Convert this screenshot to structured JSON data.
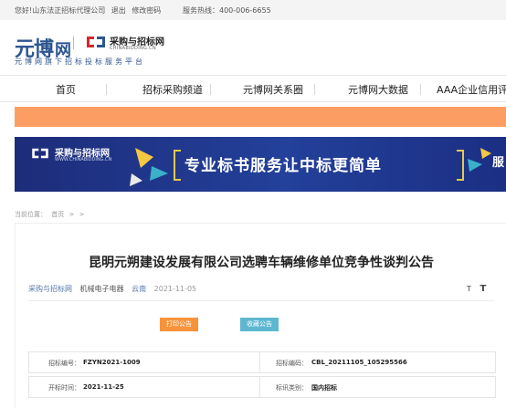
{
  "topbar": {
    "welcome_text": "您好!山东法正招标代理公司",
    "logout_label": "退出",
    "change_password_label": "修改密码",
    "hotline_text": "服务热线：400-006-6655"
  },
  "header": {
    "yuanbo_logo_text": "元博",
    "yuanbo_logo_net": "网",
    "yuanbo_sub_text": "元博网旗下招标投标服务平台",
    "caigou_name": "采购与招标网",
    "caigou_url": "CHINABIDDING.CN"
  },
  "nav": {
    "items": [
      {
        "label": "首页"
      },
      {
        "label": "招标采购频道"
      },
      {
        "label": "元博网关系圈"
      },
      {
        "label": "元博网大数据"
      },
      {
        "label": "AAA企业信用评"
      }
    ]
  },
  "banner": {
    "brand_name": "采购与招标网",
    "brand_url": "WWW.CHINABIDDING.CN",
    "slogan": "专业标书服务让中标更简单",
    "cut_text": "服"
  },
  "breadcrumb": {
    "prefix": "当前位置：",
    "home": "首页",
    "sep1": ">",
    "sep2": ">"
  },
  "article": {
    "title": "昆明元朔建设发展有限公司选聘车辆维修单位竞争性谈判公告",
    "source": "采购与招标网",
    "category": "机械电子电器",
    "region": "云南",
    "date": "2021-11-05",
    "font_small": "T",
    "font_large": "T"
  },
  "actions": {
    "print_label": "打印公告",
    "favorite_label": "收藏公告"
  },
  "info": {
    "rows": [
      {
        "label_left": "招标编号：",
        "value_left": "FZYN2021-1009",
        "label_right": "招标编码：",
        "value_right": "CBL_20211105_105295566"
      },
      {
        "label_left": "开标时间：",
        "value_left": "2021-11-25",
        "label_right": "标讯类别：",
        "value_right": "国内招标"
      }
    ]
  },
  "colors": {
    "brand_blue": "#2d5590",
    "orange_band": "#fc9e63",
    "print_button": "#f7933a",
    "favorite_button": "#5db7d1",
    "banner_blue": "#23409a",
    "caigou_red": "#d9262c"
  }
}
